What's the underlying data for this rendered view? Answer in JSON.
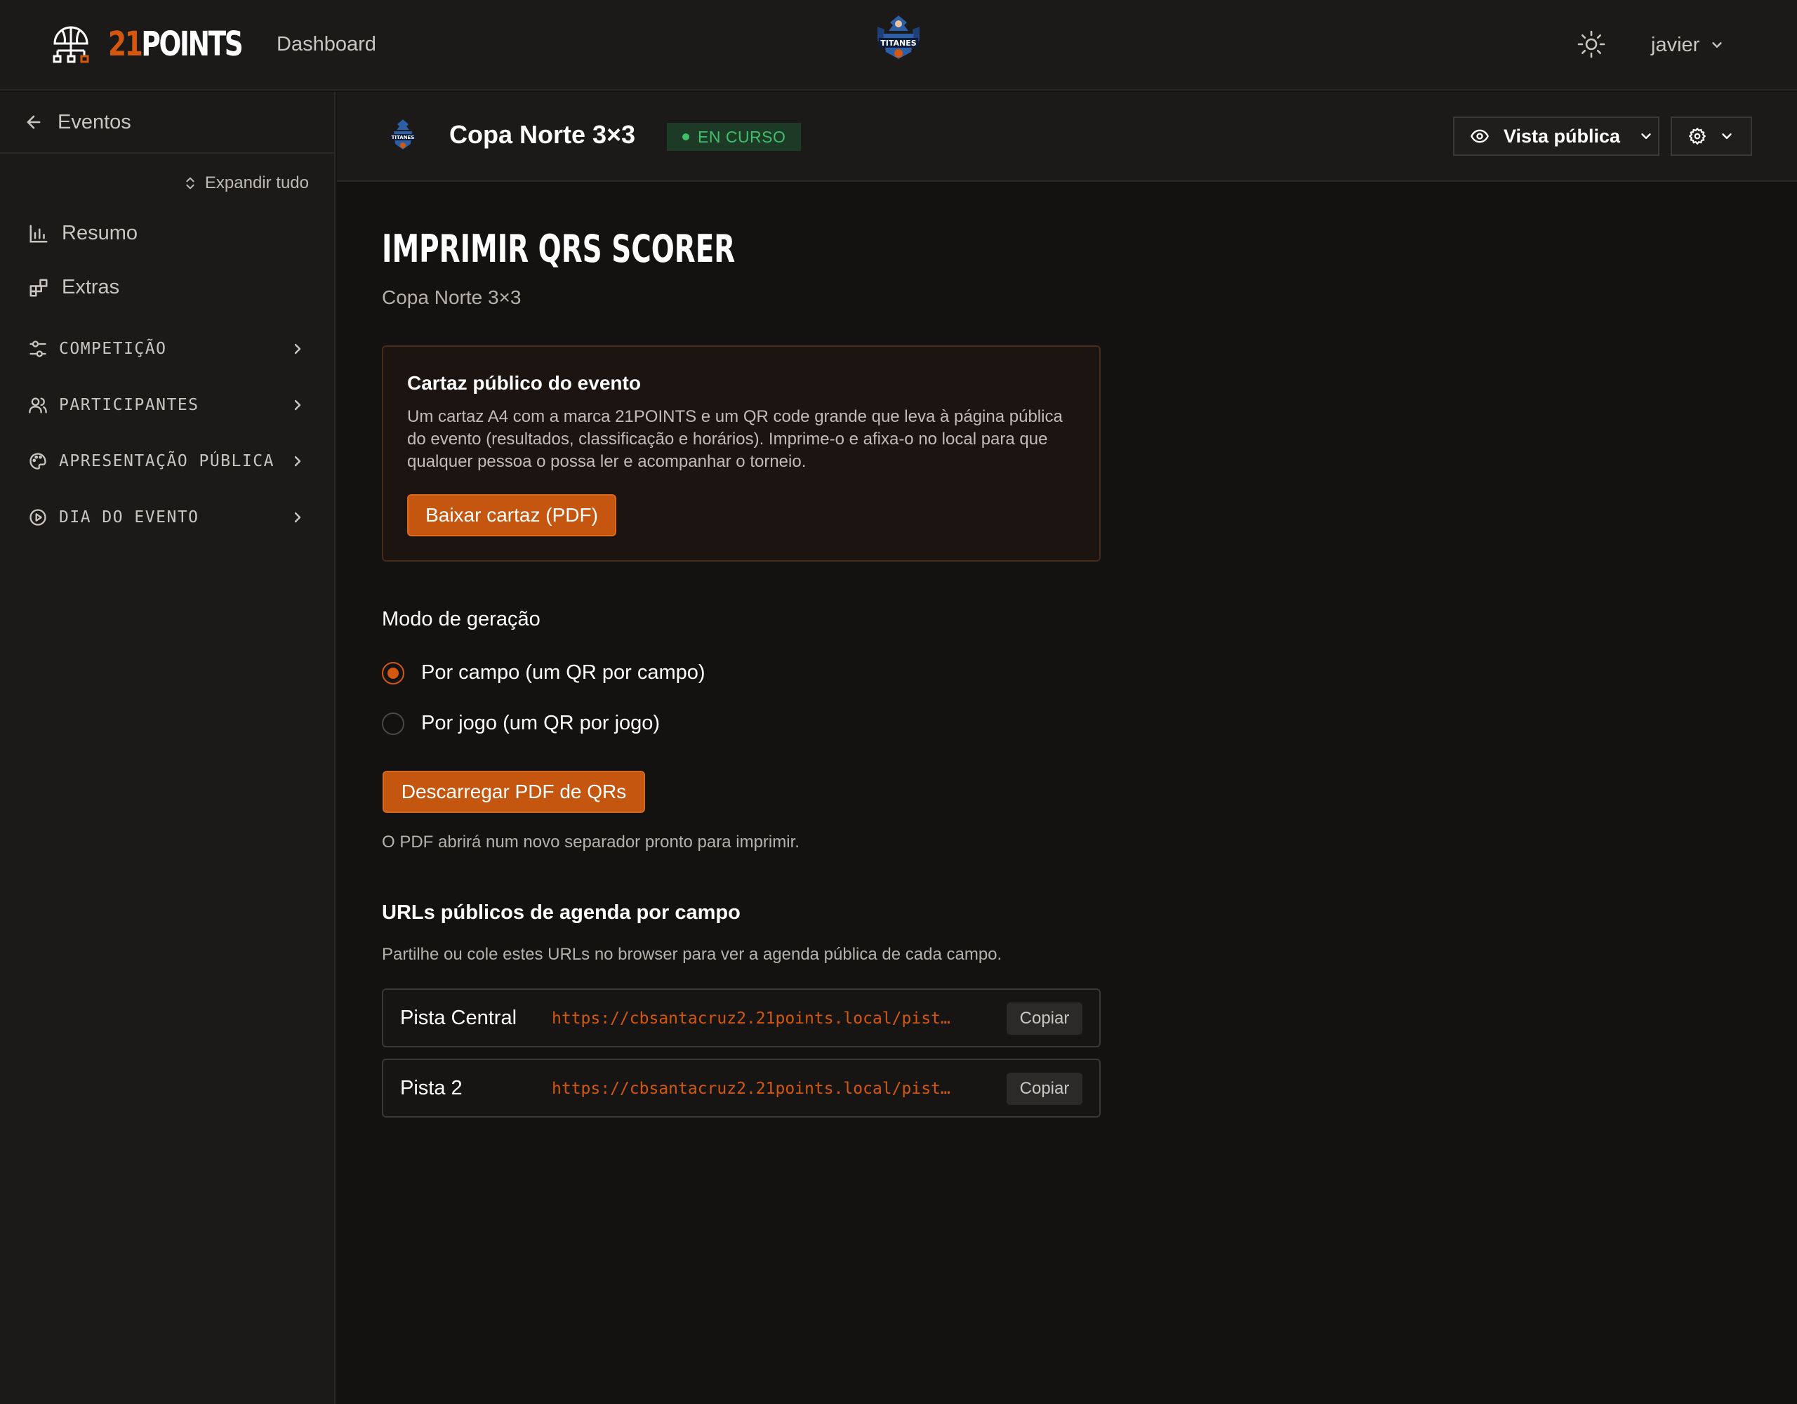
{
  "header": {
    "brand_num": "21",
    "brand_word": "POINTS",
    "nav_dashboard": "Dashboard",
    "user_name": "javier"
  },
  "sidebar": {
    "back_label": "Eventos",
    "expand_all": "Expandir tudo",
    "links": [
      {
        "label": "Resumo",
        "icon": "bar-chart-icon"
      },
      {
        "label": "Extras",
        "icon": "widgets-icon"
      }
    ],
    "groups": [
      {
        "label": "COMPETIÇÃO",
        "icon": "sliders-icon"
      },
      {
        "label": "PARTICIPANTES",
        "icon": "users-icon"
      },
      {
        "label": "APRESENTAÇÃO PÚBLICA",
        "icon": "palette-icon"
      },
      {
        "label": "DIA DO EVENTO",
        "icon": "play-circle-icon"
      }
    ]
  },
  "event": {
    "title": "Copa Norte 3×3",
    "status": "EN CURSO",
    "public_view": "Vista pública"
  },
  "main": {
    "title": "IMPRIMIR QRS SCORER",
    "subtitle": "Copa Norte 3×3",
    "poster": {
      "title": "Cartaz público do evento",
      "description": "Um cartaz A4 com a marca 21POINTS e um QR code grande que leva à página pública do evento (resultados, classificação e horários). Imprime-o e afixa-o no local para que qualquer pessoa o possa ler e acompanhar o torneio.",
      "button": "Baixar cartaz (PDF)"
    },
    "generation": {
      "label": "Modo de geração",
      "options": [
        {
          "label": "Por campo (um QR por campo)",
          "checked": true
        },
        {
          "label": "Por jogo (um QR por jogo)",
          "checked": false
        }
      ],
      "button": "Descarregar PDF de QRs",
      "help": "O PDF abrirá num novo separador pronto para imprimir."
    },
    "urls": {
      "title": "URLs públicos de agenda por campo",
      "description": "Partilhe ou cole estes URLs no browser para ver a agenda pública de cada campo.",
      "copy_label": "Copiar",
      "items": [
        {
          "name": "Pista Central",
          "url": "https://cbsantacruz2.21points.local/pista/…"
        },
        {
          "name": "Pista 2",
          "url": "https://cbsantacruz2.21points.local/pista/…"
        }
      ]
    }
  },
  "colors": {
    "accent": "#d4570f",
    "status_green": "#3fbf6a",
    "background": "#131211",
    "panel": "#1b1a19"
  }
}
